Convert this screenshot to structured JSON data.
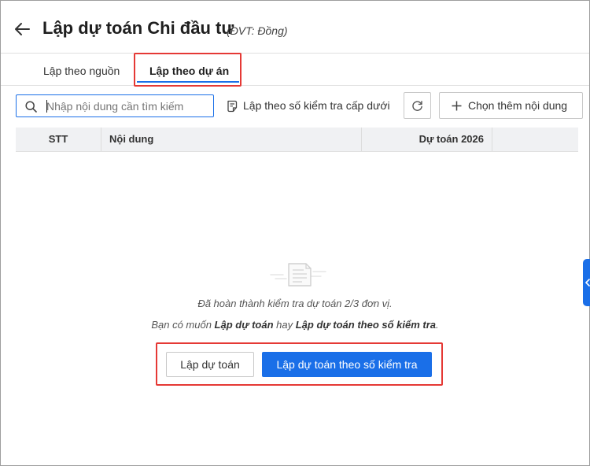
{
  "header": {
    "title": "Lập dự toán Chi đầu tư",
    "unit": "(ĐVT: Đồng)"
  },
  "tabs": [
    {
      "label": "Lập theo nguồn",
      "active": false
    },
    {
      "label": "Lập theo dự án",
      "active": true
    }
  ],
  "toolbar": {
    "search_placeholder": "Nhập nội dung cần tìm kiếm",
    "search_value": "",
    "check_label": "Lập theo số kiểm tra cấp dưới",
    "add_label": "Chọn thêm nội dung"
  },
  "table": {
    "columns": [
      "STT",
      "Nội dung",
      "Dự toán 2026",
      ""
    ],
    "rows": []
  },
  "empty_state": {
    "message_line1": "Đã hoàn thành kiểm tra dự toán 2/3 đơn vị.",
    "line2_prefix": "Bạn có muốn ",
    "line2_option1": "Lập dự toán",
    "line2_middle": " hay ",
    "line2_option2": "Lập dự toán theo số kiểm tra",
    "line2_suffix": "."
  },
  "actions": {
    "secondary_label": "Lập dự toán",
    "primary_label": "Lập dự toán theo số kiểm tra"
  },
  "colors": {
    "accent": "#1a6fe8",
    "highlight": "#e53935"
  },
  "icons": [
    "back-arrow-icon",
    "search-icon",
    "checklist-icon",
    "refresh-icon",
    "plus-icon",
    "empty-document-icon",
    "chevron-left-icon"
  ]
}
